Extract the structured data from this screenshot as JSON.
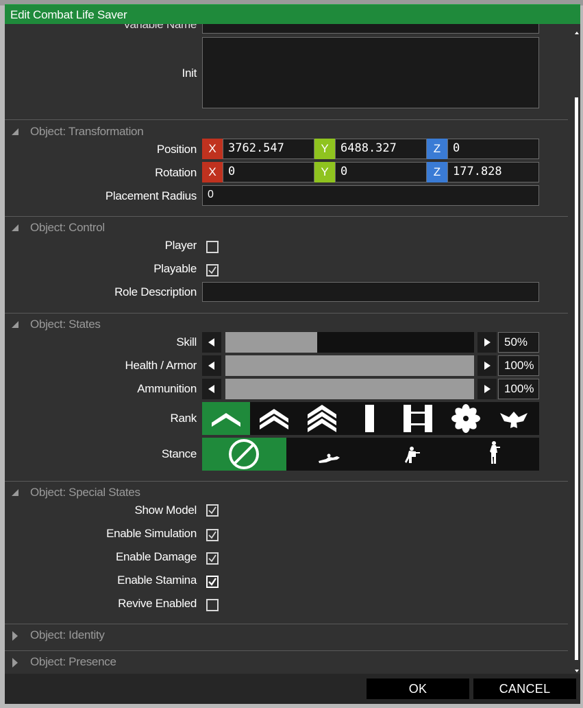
{
  "window": {
    "title": "Edit Combat Life Saver"
  },
  "top": {
    "variable_name_label": "Variable Name",
    "init_label": "Init"
  },
  "sections": {
    "transformation": "Object: Transformation",
    "control": "Object: Control",
    "states": "Object: States",
    "special": "Object: Special States",
    "identity": "Object: Identity",
    "presence": "Object: Presence"
  },
  "transformation": {
    "position_label": "Position",
    "rotation_label": "Rotation",
    "placement_label": "Placement Radius",
    "axis_x": "X",
    "axis_y": "Y",
    "axis_z": "Z",
    "position": {
      "x": "3762.547",
      "y": "6488.327",
      "z": "0"
    },
    "rotation": {
      "x": "0",
      "y": "0",
      "z": "177.828"
    },
    "placement_radius": "0",
    "axis_colors": {
      "x": "#c0321f",
      "y": "#8fc31f",
      "z": "#3a7bd5"
    }
  },
  "control": {
    "player_label": "Player",
    "player_checked": false,
    "playable_label": "Playable",
    "playable_checked": true,
    "role_label": "Role Description",
    "role_value": ""
  },
  "states": {
    "skill_label": "Skill",
    "skill_value": "50%",
    "skill_level": 0.37,
    "health_label": "Health / Armor",
    "health_value": "100%",
    "health_level": 1.0,
    "ammo_label": "Ammunition",
    "ammo_value": "100%",
    "ammo_level": 1.0,
    "rank_label": "Rank",
    "rank_icons": [
      "private-chevron-icon",
      "corporal-chevron-icon",
      "sergeant-chevron-icon",
      "lieutenant-bar-icon",
      "captain-bars-icon",
      "major-leaf-icon",
      "colonel-eagle-icon"
    ],
    "rank_selected": 0,
    "stance_label": "Stance",
    "stance_icons": [
      "no-stance-icon",
      "prone-icon",
      "crouch-icon",
      "standing-icon"
    ],
    "stance_selected": 0,
    "accent": "#1f8a3b"
  },
  "special": {
    "show_model_label": "Show Model",
    "show_model_checked": true,
    "enable_sim_label": "Enable Simulation",
    "enable_sim_checked": true,
    "enable_damage_label": "Enable Damage",
    "enable_damage_checked": true,
    "enable_stamina_label": "Enable Stamina",
    "enable_stamina_checked": true,
    "revive_label": "Revive Enabled",
    "revive_checked": false
  },
  "footer": {
    "ok_label": "OK",
    "cancel_label": "CANCEL"
  }
}
